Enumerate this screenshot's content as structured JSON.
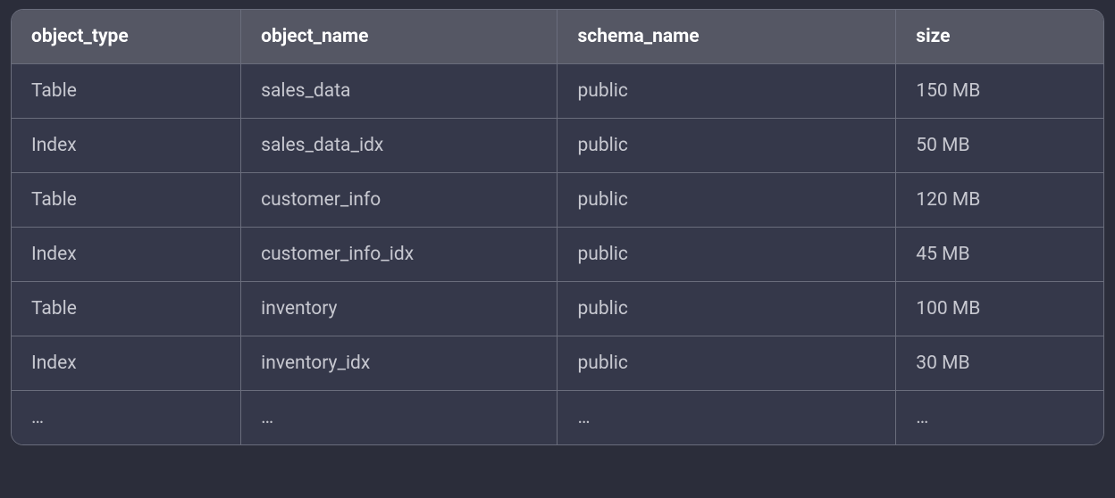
{
  "table": {
    "headers": [
      "object_type",
      "object_name",
      "schema_name",
      "size"
    ],
    "rows": [
      [
        "Table",
        "sales_data",
        "public",
        "150 MB"
      ],
      [
        "Index",
        "sales_data_idx",
        "public",
        "50 MB"
      ],
      [
        "Table",
        "customer_info",
        "public",
        "120 MB"
      ],
      [
        "Index",
        "customer_info_idx",
        "public",
        "45 MB"
      ],
      [
        "Table",
        "inventory",
        "public",
        "100 MB"
      ],
      [
        "Index",
        "inventory_idx",
        "public",
        "30 MB"
      ],
      [
        "…",
        "…",
        "…",
        "…"
      ]
    ]
  }
}
